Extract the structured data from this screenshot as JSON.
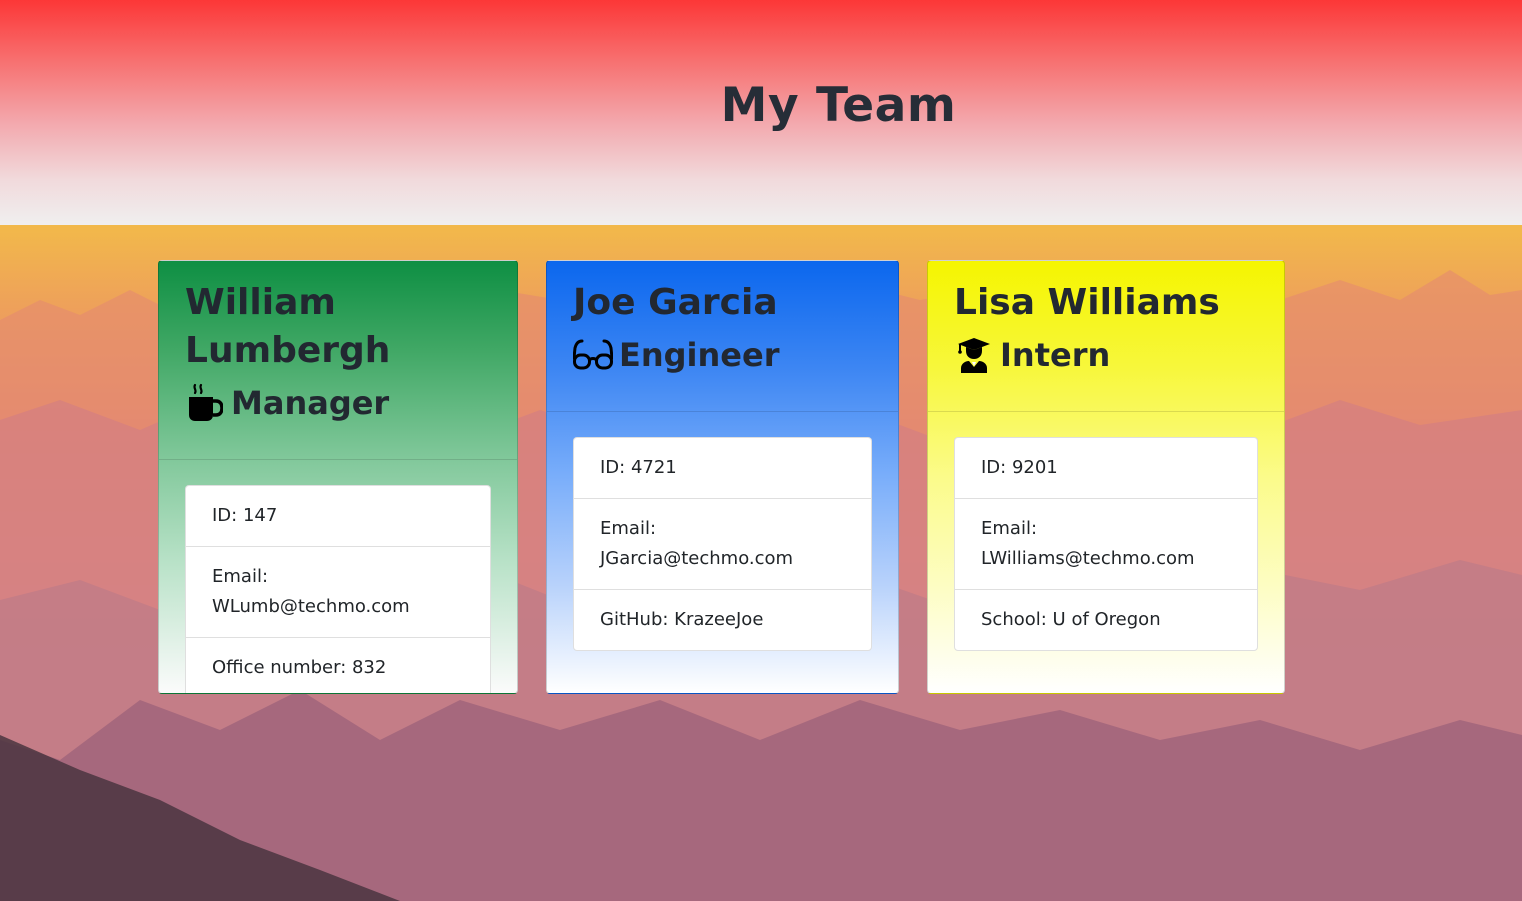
{
  "page": {
    "title": "My Team"
  },
  "colors": {
    "header_top": "#fc3737",
    "manager_accent": "#0e8f43",
    "engineer_accent": "#0b67ee",
    "intern_accent": "#f5f500"
  },
  "team": {
    "manager": {
      "name": "William Lumbergh",
      "role": "Manager",
      "role_icon": "coffee-mug-icon",
      "id": "ID: 147",
      "email": "Email: WLumb@techmo.com",
      "extra": "Office number: 832"
    },
    "engineer": {
      "name": "Joe Garcia",
      "role": "Engineer",
      "role_icon": "glasses-icon",
      "id": "ID: 4721",
      "email": "Email: JGarcia@techmo.com",
      "extra": "GitHub: KrazeeJoe"
    },
    "intern": {
      "name": "Lisa Williams",
      "role": "Intern",
      "role_icon": "graduate-icon",
      "id": "ID: 9201",
      "email": "Email: LWilliams@techmo.com",
      "extra": "School: U of Oregon"
    }
  }
}
